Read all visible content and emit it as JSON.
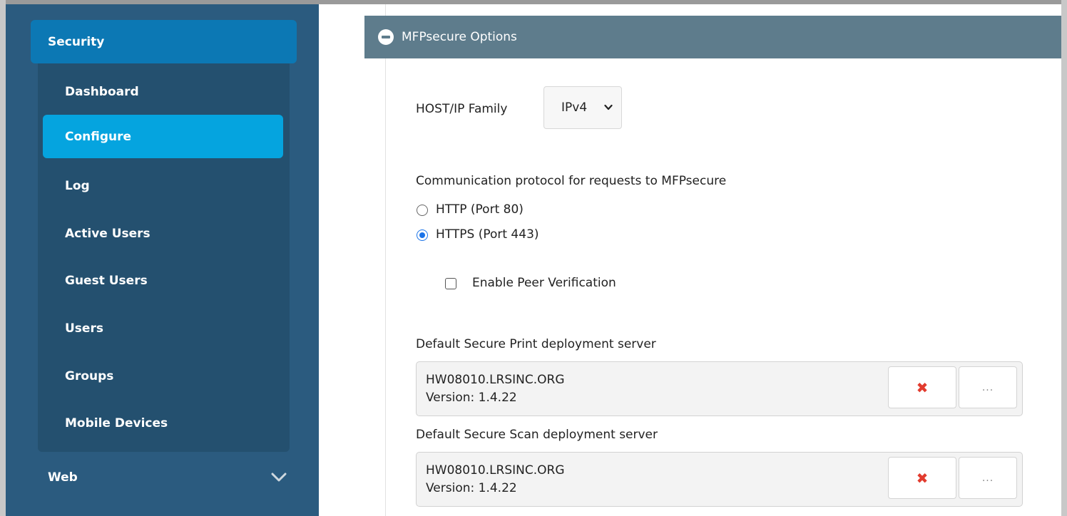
{
  "sidebar": {
    "section_label": "Security",
    "items": [
      {
        "label": "Dashboard"
      },
      {
        "label": "Configure"
      },
      {
        "label": "Log"
      },
      {
        "label": "Active Users"
      },
      {
        "label": "Guest Users"
      },
      {
        "label": "Users"
      },
      {
        "label": "Groups"
      },
      {
        "label": "Mobile Devices"
      }
    ],
    "active_item": "Configure",
    "web_label": "Web"
  },
  "panel": {
    "title": "MFPsecure Options"
  },
  "host_family": {
    "label": "HOST/IP Family",
    "selected": "IPv4"
  },
  "protocol": {
    "label": "Communication protocol for requests to MFPsecure",
    "options": [
      {
        "label": "HTTP (Port 80)",
        "checked": false
      },
      {
        "label": "HTTPS (Port 443)",
        "checked": true
      }
    ]
  },
  "peer_verification": {
    "label": "Enable Peer Verification",
    "checked": false
  },
  "print_server": {
    "label": "Default Secure Print deployment server",
    "name": "HW08010.LRSINC.ORG",
    "version": "Version: 1.4.22",
    "browse_label": "..."
  },
  "scan_server": {
    "label": "Default Secure Scan deployment server",
    "name": "HW08010.LRSINC.ORG",
    "version": "Version: 1.4.22",
    "browse_label": "..."
  },
  "colors": {
    "sidebar_bg": "#2b5b7f",
    "section_header": "#0c78b4",
    "active_item": "#05a4df",
    "panel_header": "#5e7c8c",
    "remove_icon": "#e23b2e"
  }
}
